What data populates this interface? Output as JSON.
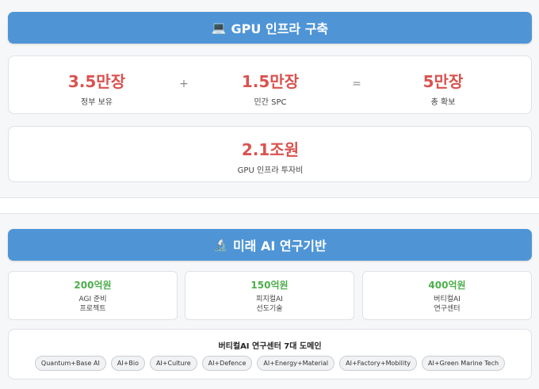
{
  "gpu": {
    "header_emoji": "💻",
    "header_title": "GPU 인프라 구축",
    "stats": [
      {
        "value": "3.5만장",
        "label": "정부 보유"
      },
      {
        "value": "1.5만장",
        "label": "민간 SPC"
      },
      {
        "value": "5만장",
        "label": "총 확보"
      }
    ],
    "op_plus": "+",
    "op_equals": "=",
    "investment": {
      "value": "2.1조원",
      "label": "GPU 인프라 투자비"
    }
  },
  "research": {
    "header_emoji": "🔬",
    "header_title": "미래 AI 연구기반",
    "budgets": [
      {
        "amount": "200억원",
        "line1": "AGI 준비",
        "line2": "프로젝트"
      },
      {
        "amount": "150억원",
        "line1": "피지컬AI",
        "line2": "선도기술"
      },
      {
        "amount": "400억원",
        "line1": "버티컬AI",
        "line2": "연구센터"
      }
    ],
    "domains_title": "버티컬AI 연구센터 7대 도메인",
    "domains": [
      "Quantum+Base AI",
      "AI+Bio",
      "AI+Culture",
      "AI+Defence",
      "AI+Energy+Material",
      "AI+Factory+Mobility",
      "AI+Green Marine Tech"
    ]
  },
  "colors": {
    "header_bg": "#4f95d6",
    "stat_red": "#d9534f",
    "budget_green": "#4cae4c"
  }
}
